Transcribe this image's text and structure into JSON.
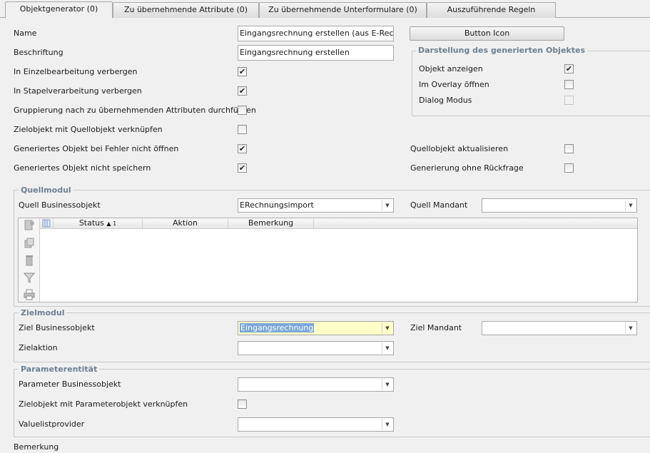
{
  "tabs": [
    {
      "label": "Objektgenerator (0)"
    },
    {
      "label": "Zu übernehmende Attribute (0)"
    },
    {
      "label": "Zu übernehmende Unterformulare (0)"
    },
    {
      "label": "Auszuführende Regeln"
    }
  ],
  "form": {
    "name_label": "Name",
    "name_value": "Eingangsrechnung erstellen (aus E-Rechnung",
    "beschriftung_label": "Beschriftung",
    "beschriftung_value": "Eingangsrechnung erstellen",
    "button_icon_label": "Button Icon",
    "einzel_label": "In Einzelbearbeitung verbergen",
    "stapel_label": "In Stapelverarbeitung verbergen",
    "gruppierung_label": "Gruppierung nach zu übernehmenden Attributen durchführen",
    "zielobjekt_label": "Zielobjekt mit Quellobjekt verknüpfen",
    "fehler_label": "Generiertes Objekt bei Fehler nicht öffnen",
    "nicht_speichern_label": "Generiertes Objekt nicht speichern",
    "quellobjekt_akt_label": "Quellobjekt aktualisieren",
    "ohne_rueckfrage_label": "Generierung ohne Rückfrage",
    "check_mark": "✔"
  },
  "darstellung": {
    "title": "Darstellung des generierten Objektes",
    "anzeigen_label": "Objekt anzeigen",
    "overlay_label": "Im Overlay öffnen",
    "dialog_label": "Dialog Modus"
  },
  "quellmodul": {
    "title": "Quellmodul",
    "bo_label": "Quell Businessobjekt",
    "bo_value": "ERechnungsimport",
    "mandant_label": "Quell Mandant",
    "mandant_value": "",
    "columns": [
      "Status",
      "Aktion",
      "Bemerkung"
    ],
    "sort_indicator": "▲ 1"
  },
  "zielmodul": {
    "title": "Zielmodul",
    "bo_label": "Ziel Businessobjekt",
    "bo_value": "Eingangsrechnung",
    "mandant_label": "Ziel Mandant",
    "mandant_value": "",
    "aktion_label": "Zielaktion",
    "aktion_value": ""
  },
  "parameter": {
    "title": "Parameterentität",
    "bo_label": "Parameter Businessobjekt",
    "bo_value": "",
    "verknuepfen_label": "Zielobjekt mit Parameterobjekt verknüpfen",
    "vlp_label": "Valuelistprovider",
    "vlp_value": ""
  },
  "bemerkung_label": "Bemerkung",
  "arrow_glyph": "▼"
}
